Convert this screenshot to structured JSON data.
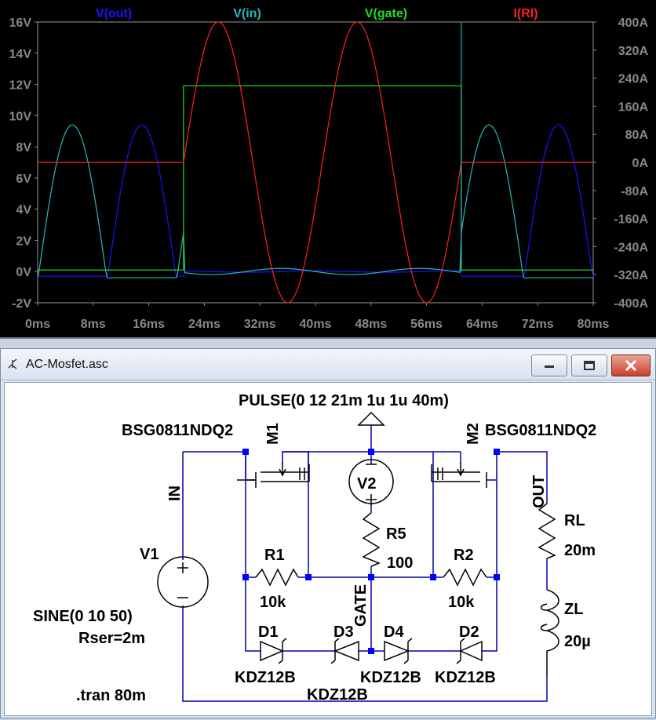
{
  "chart_data": {
    "type": "line",
    "x": {
      "min": 0,
      "max": 80,
      "unit": "ms",
      "ticks": [
        "0ms",
        "8ms",
        "16ms",
        "24ms",
        "32ms",
        "40ms",
        "48ms",
        "56ms",
        "64ms",
        "72ms",
        "80ms"
      ]
    },
    "y_left": {
      "min": -2,
      "max": 16,
      "unit": "V",
      "ticks": [
        "16V",
        "14V",
        "12V",
        "10V",
        "8V",
        "6V",
        "4V",
        "2V",
        "0V",
        "-2V"
      ]
    },
    "y_right": {
      "min": -400,
      "max": 400,
      "unit": "A",
      "ticks": [
        "400A",
        "320A",
        "240A",
        "160A",
        "80A",
        "0A",
        "-80A",
        "-160A",
        "-240A",
        "-320A",
        "-400A"
      ]
    },
    "grid": false,
    "series": [
      {
        "name": "V(out)",
        "color": "#1515ff",
        "axis": "left",
        "description": "Rectified sine peaks ~9.4V at 15ms, 75ms; ~-0.3V otherwise"
      },
      {
        "name": "V(in)",
        "color": "#2ab7b7",
        "axis": "left",
        "description": "Sine peaks ~9.4V at 5ms, 65ms; ~-0.4V otherwise"
      },
      {
        "name": "V(gate)",
        "color": "#22dd22",
        "axis": "left",
        "points": [
          [
            0,
            0.1
          ],
          [
            21,
            0.1
          ],
          [
            21,
            11.9
          ],
          [
            61,
            11.9
          ],
          [
            61,
            0.1
          ],
          [
            80,
            0.1
          ]
        ]
      },
      {
        "name": "I(Rl)",
        "color": "#ff2020",
        "axis": "right",
        "points": [
          [
            0,
            0
          ],
          [
            21,
            0
          ],
          [
            26,
            400
          ],
          [
            36,
            -400
          ],
          [
            46,
            400
          ],
          [
            56,
            -400
          ],
          [
            61,
            0
          ],
          [
            80,
            0
          ]
        ]
      }
    ]
  },
  "window": {
    "title": "AC-Mosfet.asc"
  },
  "schematic": {
    "pulse": "PULSE(0 12 21m 1u 1u 40m)",
    "m1_model": "BSG0811NDQ2",
    "m1_name": "M1",
    "m2_model": "BSG0811NDQ2",
    "m2_name": "M2",
    "v2": "V2",
    "v1": "V1",
    "in_label": "IN",
    "out_label": "OUT",
    "gate_label": "GATE",
    "r5": "R5",
    "r5_val": "100",
    "r1": "R1",
    "r1_val": "10k",
    "r2": "R2",
    "r2_val": "10k",
    "rl": "RL",
    "rl_val": "20m",
    "zl": "ZL",
    "zl_val": "20µ",
    "sine": "SINE(0 10 50)",
    "rser": "Rser=2m",
    "d1": "D1",
    "d2": "D2",
    "d3": "D3",
    "d4": "D4",
    "d1_model": "KDZ12B",
    "d2_model": "KDZ12B",
    "d3_model": "KDZ12B",
    "d4_model": "KDZ12B",
    "tran": ".tran 80m"
  }
}
